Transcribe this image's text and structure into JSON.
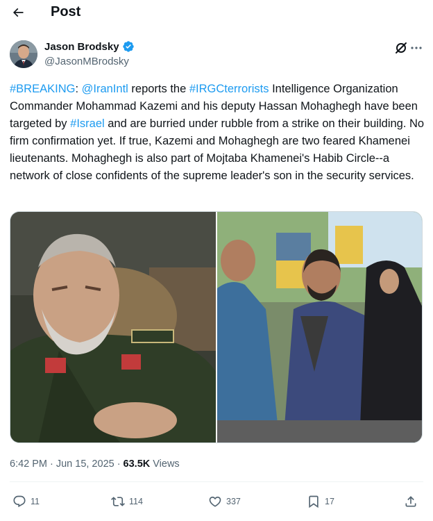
{
  "header": {
    "title": "Post"
  },
  "author": {
    "display_name": "Jason Brodsky",
    "handle": "@JasonMBrodsky",
    "verified": true
  },
  "tweet": {
    "segments": [
      {
        "text": "#BREAKING",
        "link": true
      },
      {
        "text": ": ",
        "link": false
      },
      {
        "text": "@IranIntl",
        "link": true
      },
      {
        "text": " reports the ",
        "link": false
      },
      {
        "text": "#IRGCterrorists",
        "link": true
      },
      {
        "text": " Intelligence Organization Commander Mohammad Kazemi and his deputy Hassan Mohaghegh have been targeted by ",
        "link": false
      },
      {
        "text": "#Israel",
        "link": true
      },
      {
        "text": " and are burried under rubble from a strike on their building. No firm confirmation yet. If true, Kazemi and Mohaghegh are two feared Khamenei lieutenants. Mohaghegh is also part of Mojtaba Khamenei's Habib Circle--a network of close confidents of the supreme leader's son in the security services.",
        "link": false
      }
    ]
  },
  "meta": {
    "time": "6:42 PM",
    "separator1": "·",
    "date": "Jun 15, 2025",
    "separator2": "·",
    "views_count": "63.5K",
    "views_label": "Views"
  },
  "actions": {
    "replies": "11",
    "reposts": "114",
    "likes": "337",
    "bookmarks": "17"
  },
  "colors": {
    "link": "#1d9bf0",
    "verified": "#1d9bf0",
    "secondary_text": "#536471"
  },
  "icons": [
    "back-arrow-icon",
    "verified-badge-icon",
    "grok-icon",
    "more-icon",
    "reply-icon",
    "repost-icon",
    "like-icon",
    "bookmark-icon",
    "share-icon"
  ]
}
